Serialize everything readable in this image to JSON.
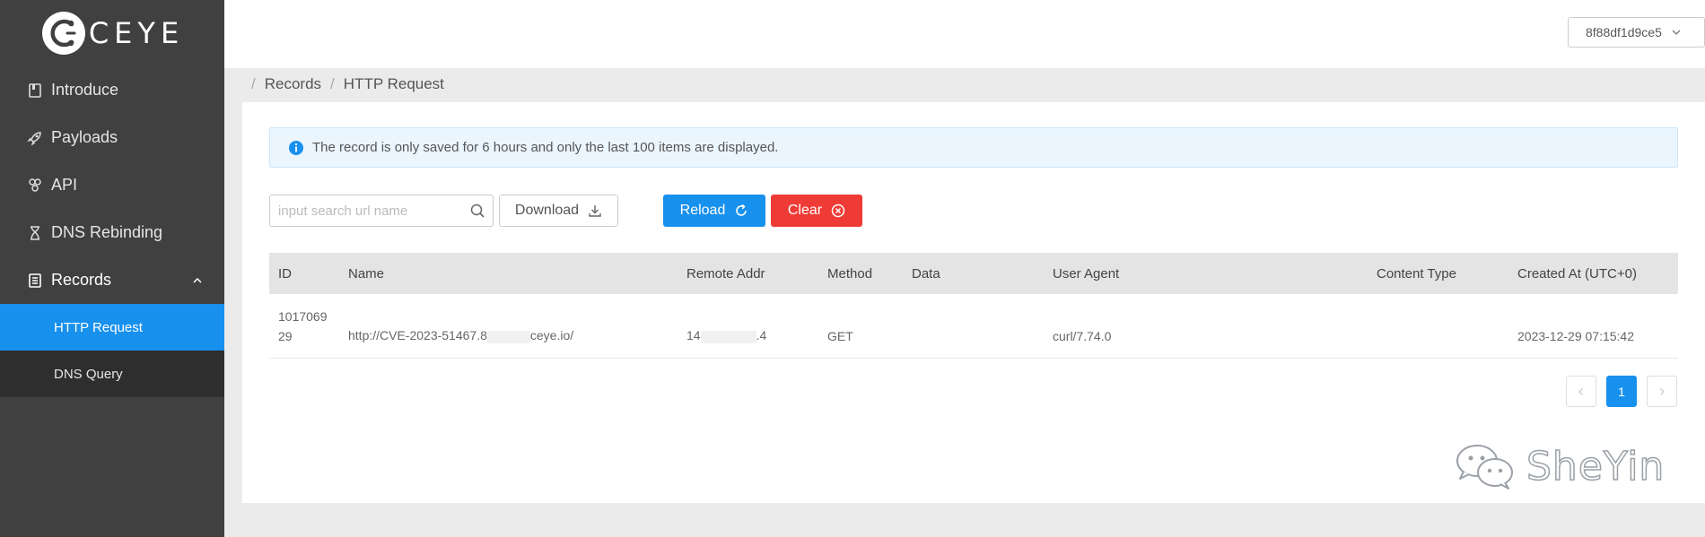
{
  "app": {
    "logo_text": "CEYE"
  },
  "sidebar": {
    "items": [
      {
        "label": "Introduce",
        "icon": "book-icon"
      },
      {
        "label": "Payloads",
        "icon": "rocket-icon"
      },
      {
        "label": "API",
        "icon": "api-icon"
      },
      {
        "label": "DNS Rebinding",
        "icon": "hourglass-icon"
      },
      {
        "label": "Records",
        "icon": "records-icon",
        "expanded": true
      }
    ],
    "submenu": [
      {
        "label": "HTTP Request",
        "active": true
      },
      {
        "label": "DNS Query",
        "active": false
      }
    ]
  },
  "header": {
    "user": "8f88df1d9ce5"
  },
  "breadcrumb": {
    "items": [
      "Records",
      "HTTP Request"
    ]
  },
  "alert": {
    "text": "The record is only saved for 6 hours and only the last 100 items are displayed."
  },
  "toolbar": {
    "search_placeholder": "input search url name",
    "download_label": "Download",
    "reload_label": "Reload",
    "clear_label": "Clear"
  },
  "table": {
    "columns": [
      "ID",
      "Name",
      "Remote Addr",
      "Method",
      "Data",
      "User Agent",
      "Content Type",
      "Created At (UTC+0)"
    ],
    "rows": [
      {
        "id": "101706929",
        "name": "http://CVE-2023-51467.8",
        "name_tail": "ceye.io/",
        "remote_addr": "14",
        "remote_addr_tail": ".4",
        "method": "GET",
        "data": "",
        "user_agent": "curl/7.74.0",
        "content_type": "",
        "created_at": "2023-12-29 07:15:42"
      }
    ]
  },
  "pagination": {
    "current": "1"
  },
  "watermark": {
    "text": "SheYin"
  },
  "colors": {
    "accent": "#1890ee",
    "danger": "#ef3b36",
    "sidebar": "#404040"
  }
}
